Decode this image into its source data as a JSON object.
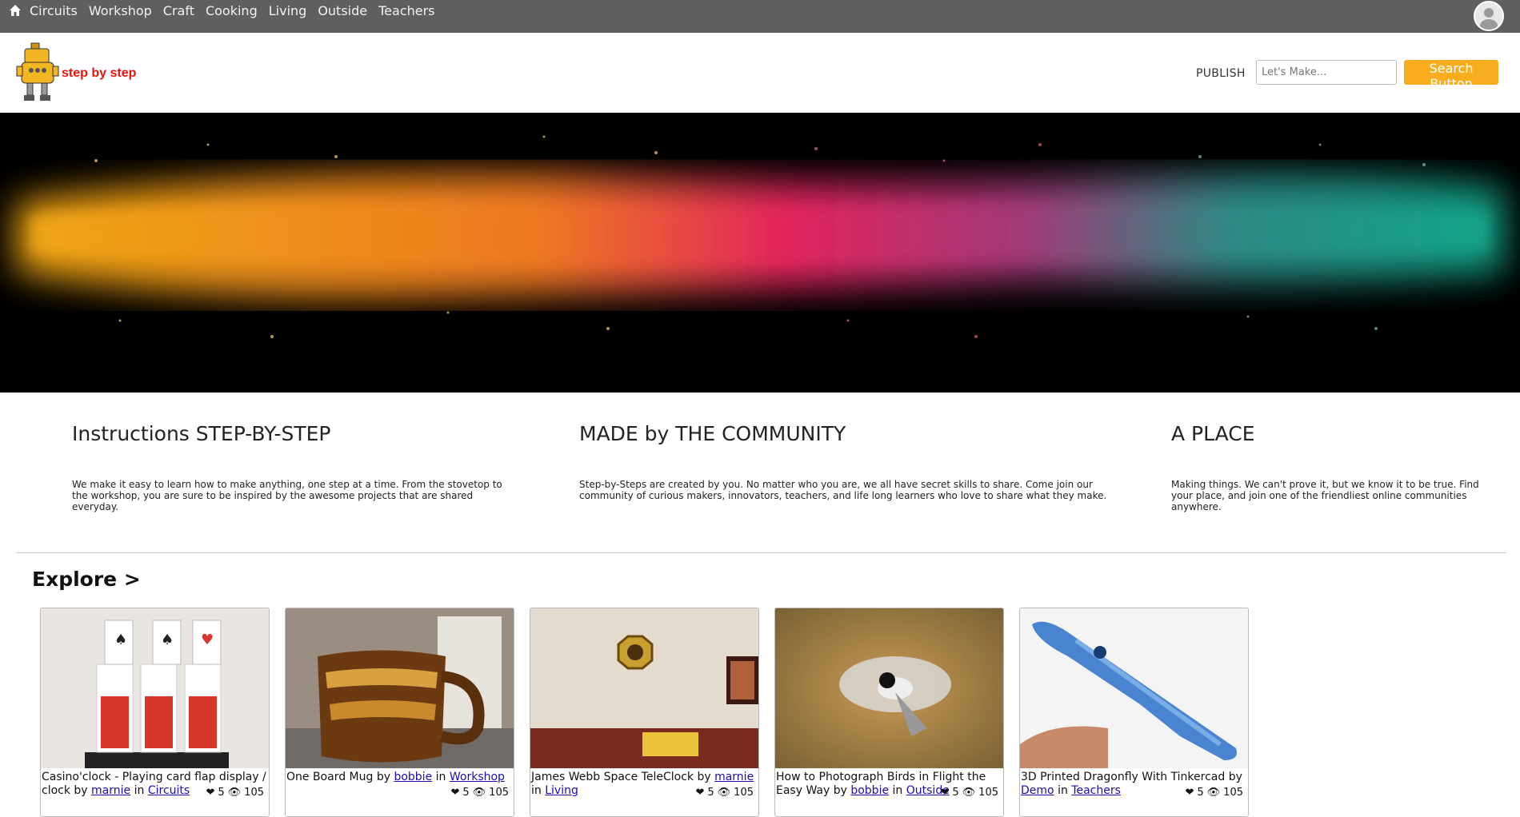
{
  "nav": {
    "items": [
      "Circuits",
      "Workshop",
      "Craft",
      "Cooking",
      "Living",
      "Outside",
      "Teachers"
    ]
  },
  "header": {
    "brand": "step by step",
    "publish_label": "PUBLISH",
    "search_placeholder": "Let's Make...",
    "search_button": "Search Button"
  },
  "info": [
    {
      "title": "Instructions STEP-BY-STEP",
      "text": "We make it easy to learn how to make anything, one step at a time. From the stovetop to the workshop, you are sure to be inspired by the awesome projects that are shared everyday."
    },
    {
      "title": "MADE by THE COMMUNITY",
      "text": "Step-by-Steps are created by you. No matter who you are, we all have secret skills to share. Come join our community of curious makers, innovators, teachers, and life long learners who love to share what they make."
    },
    {
      "title": "A PLACE",
      "text": "Making things. We can't prove it, but we know it to be true. Find your place, and join one of the friendliest online communities anywhere."
    }
  ],
  "explore_label": "Explore >",
  "cards": [
    {
      "title": "Casino'clock - Playing card flap display / clock",
      "author": "marnie",
      "category": "Circuits",
      "likes": "5",
      "views": "105"
    },
    {
      "title": "One Board Mug",
      "author": "bobbie",
      "category": "Workshop",
      "likes": "5",
      "views": "105"
    },
    {
      "title": "James Webb Space TeleClock",
      "author": "marnie",
      "category": "Living",
      "likes": "5",
      "views": "105"
    },
    {
      "title": "How to Photograph Birds in Flight the Easy Way",
      "author": "bobbie",
      "category": "Outside",
      "likes": "5",
      "views": "105"
    },
    {
      "title": "3D Printed Dragonfly With Tinkercad",
      "author": "Demo",
      "category": "Teachers",
      "likes": "5",
      "views": "105"
    }
  ],
  "words": {
    "by": "by",
    "in": "in"
  },
  "colors": {
    "nav_bg": "#5f5f5f",
    "brand": "#e8120c",
    "accent": "#f7ad1e",
    "link": "#1a0dab"
  }
}
